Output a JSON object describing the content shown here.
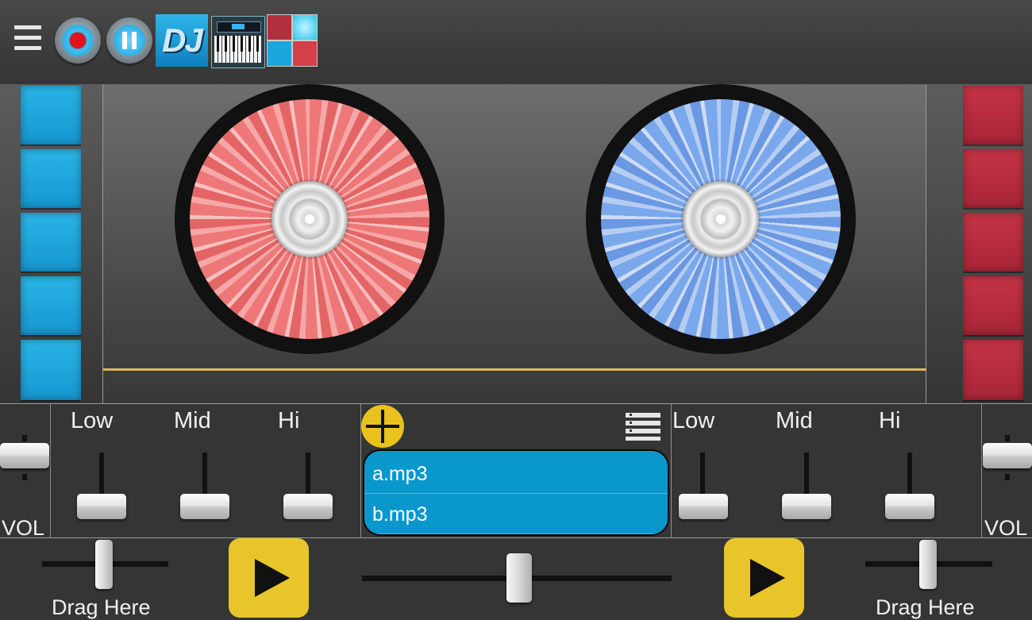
{
  "toolbar": {
    "items": [
      "menu-icon",
      "record-icon",
      "pause-icon",
      "dj-mode-icon",
      "keyboard-icon",
      "drum-pads-icon"
    ],
    "dj_label": "DJ"
  },
  "colors": {
    "deck_a": "#ee7878",
    "deck_b": "#7aa8ec",
    "pad_blue": "#1ba7de",
    "pad_red": "#b02a3c",
    "accent_yellow": "#e8c52a",
    "playlist_bg": "#0a97cc",
    "seek_line": "#e2b45a"
  },
  "left_deck": {
    "eq_labels": {
      "low": "Low",
      "mid": "Mid",
      "hi": "Hi"
    },
    "vol_label": "VOL",
    "drag_label": "Drag Here"
  },
  "right_deck": {
    "eq_labels": {
      "low": "Low",
      "mid": "Mid",
      "hi": "Hi"
    },
    "vol_label": "VOL",
    "drag_label": "Drag Here"
  },
  "playlist": {
    "items": [
      "a.mp3",
      "b.mp3"
    ]
  }
}
